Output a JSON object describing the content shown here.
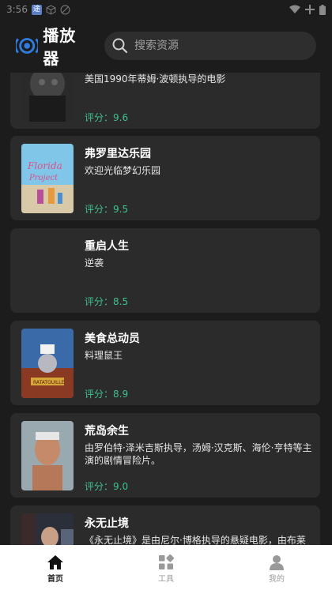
{
  "status_bar": {
    "time": "3:56"
  },
  "header": {
    "app_title": "播放器",
    "search_placeholder": "搜索资源"
  },
  "movies": [
    {
      "title": "",
      "desc": "美国1990年蒂姆·波顿执导的电影",
      "rating": "评分：9.6",
      "poster": "dark-gothic"
    },
    {
      "title": "弗罗里达乐园",
      "desc": "欢迎光临梦幻乐园",
      "rating": "评分：9.5",
      "poster": "florida-project"
    },
    {
      "title": "重启人生",
      "desc": "逆袭",
      "rating": "评分：8.5",
      "poster": "none"
    },
    {
      "title": "美食总动员",
      "desc": "料理鼠王",
      "rating": "评分：8.9",
      "poster": "ratatouille"
    },
    {
      "title": "荒岛余生",
      "desc": "由罗伯特·泽米吉斯执导，汤姆·汉克斯、海伦·亨特等主演的剧情冒险片。",
      "rating": "评分：9.0",
      "poster": "cast-away"
    },
    {
      "title": "永无止境",
      "desc": "《永无止境》是由尼尔·博格执导的悬疑电影，由布莱",
      "rating": "",
      "poster": "limitless"
    }
  ],
  "bottom_nav": [
    {
      "label": "首页",
      "icon": "home-icon",
      "active": true
    },
    {
      "label": "工具",
      "icon": "tools-icon",
      "active": false
    },
    {
      "label": "我的",
      "icon": "profile-icon",
      "active": false
    }
  ],
  "colors": {
    "background": "#1c1c1c",
    "card": "#2b2b2b",
    "rating": "#3ec28f",
    "accent": "#2f7de1"
  }
}
